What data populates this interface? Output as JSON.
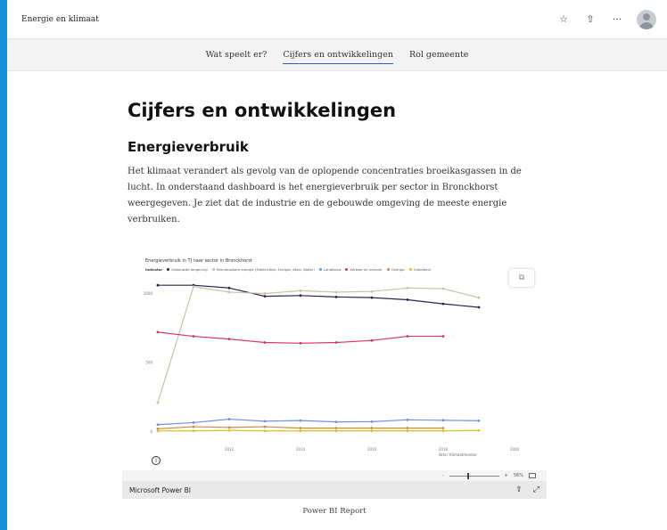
{
  "header": {
    "site_title": "Energie en klimaat",
    "icons": [
      "star-icon",
      "share-icon",
      "more-icon",
      "avatar-icon"
    ],
    "more_glyph": "···"
  },
  "nav": {
    "items": [
      {
        "label": "Wat speelt er?",
        "active": false
      },
      {
        "label": "Cijfers en ontwikkelingen",
        "active": true
      },
      {
        "label": "Rol gemeente",
        "active": false
      }
    ]
  },
  "main": {
    "title": "Cijfers en ontwikkelingen",
    "section_heading": "Energieverbruik",
    "paragraph": "Het klimaat verandert als gevolg van de oplopende concentraties broeikasgassen in de lucht. In onderstaand dashboard is het energieverbruik per sector in Bronckhorst weergegeven. Je ziet dat de industrie en de gebouwde omgeving de meeste energie verbruiken."
  },
  "report": {
    "zoom_level": "56%",
    "product_name": "Microsoft Power BI",
    "caption": "Power BI Report",
    "source": "Bron: Klimaatmonitor",
    "info_glyph": "i",
    "popout_glyph": "⧉",
    "zoom_minus": "-",
    "zoom_plus": "+",
    "share_glyph": "⇪",
    "expand_glyph": "⤢"
  },
  "chart_data": {
    "type": "line",
    "title": "Energieverbruik in TJ naar sector in Bronckhorst",
    "legend_title": "Indicator",
    "legend_position": "top-left",
    "grid": false,
    "x": [
      "2010",
      "2011",
      "2012",
      "2013",
      "2014",
      "2015",
      "2016",
      "2017",
      "2018",
      "2019",
      "2020"
    ],
    "x_tick_labels": [
      "2012",
      "2014",
      "2016",
      "2018",
      "2020"
    ],
    "y_tick_labels": [
      "1000",
      "500",
      "0"
    ],
    "ylim": [
      -100,
      1100
    ],
    "series": [
      {
        "name": "Gebouwde omgeving",
        "color": "#2a2350",
        "values": [
          1060,
          1060,
          1040,
          980,
          985,
          975,
          970,
          955,
          925,
          900,
          null
        ]
      },
      {
        "name": "Hernieuwbare energie (Elektriciteit, Energie, Afval, Water)",
        "color": "#c9c2a4",
        "values": [
          210,
          1050,
          1010,
          1000,
          1020,
          1010,
          1015,
          1040,
          1035,
          970,
          null
        ]
      },
      {
        "name": "Landbouw",
        "color": "#6f8fe6",
        "values": [
          50,
          65,
          90,
          75,
          80,
          70,
          72,
          85,
          82,
          78,
          null
        ]
      },
      {
        "name": "Verkeer en vervoer",
        "color": "#d6336f",
        "values": [
          720,
          690,
          670,
          645,
          640,
          645,
          660,
          690,
          690,
          null,
          null
        ]
      },
      {
        "name": "Overige",
        "color": "#c98a4a",
        "values": [
          20,
          35,
          30,
          35,
          25,
          25,
          25,
          25,
          25,
          null,
          null
        ]
      },
      {
        "name": "Onbekend",
        "color": "#e0c020",
        "values": [
          5,
          5,
          8,
          5,
          5,
          5,
          5,
          5,
          5,
          8,
          null
        ]
      }
    ]
  },
  "colors": {
    "accent": "#2b5fb5",
    "background_edge": "#1a8fd9"
  }
}
